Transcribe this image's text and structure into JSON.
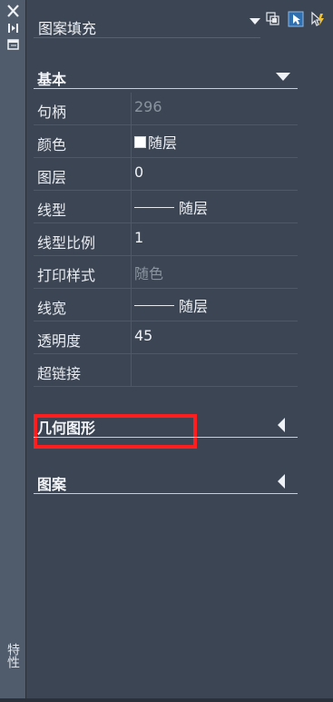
{
  "left_strip": {
    "close_icon": "close-icon",
    "label": "特性"
  },
  "selector": {
    "value": "图案填充"
  },
  "toolbar": {
    "buttons": [
      "toggle-pickadd-icon",
      "select-objects-icon",
      "quick-select-icon"
    ]
  },
  "sections": [
    {
      "title": "基本",
      "expanded": true
    },
    {
      "title": "几何图形",
      "expanded": false
    },
    {
      "title": "图案",
      "expanded": false
    }
  ],
  "rows": [
    {
      "label": "句柄",
      "value": "296",
      "dim": true
    },
    {
      "label": "颜色",
      "value": "随层",
      "swatch_color": "#ffffff"
    },
    {
      "label": "图层",
      "value": "0"
    },
    {
      "label": "线型",
      "value": "随层",
      "line_sample": true
    },
    {
      "label": "线型比例",
      "value": "1"
    },
    {
      "label": "打印样式",
      "value": "随色",
      "dim": true
    },
    {
      "label": "线宽",
      "value": "随层",
      "line_sample": true
    },
    {
      "label": "透明度",
      "value": "45"
    },
    {
      "label": "超链接",
      "value": ""
    }
  ],
  "colors": {
    "panel_bg": "#3c4553",
    "strip_bg": "#505c6b",
    "highlight": "#ff1d1d",
    "text": "#e9ecf0",
    "dim_text": "#8a93a0"
  }
}
